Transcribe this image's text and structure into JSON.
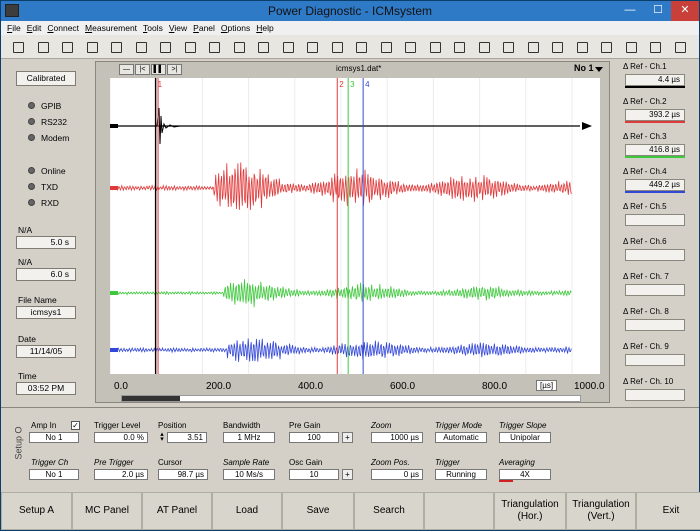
{
  "window": {
    "title": "Power Diagnostic - ICMsystem",
    "controls": [
      "—",
      "☐",
      "✕"
    ]
  },
  "menu": [
    "File",
    "Edit",
    "Connect",
    "Measurement",
    "Tools",
    "View",
    "Panel",
    "Options",
    "Help"
  ],
  "toolbar_icons": [
    "open-icon",
    "save-icon",
    "print-icon",
    "grid-icon",
    "stop-icon",
    "text-icon",
    "bars-icon",
    "chart-icon",
    "spectrum-icon",
    "spectrum2-icon",
    "list-icon",
    "table-icon",
    "waveform-icon",
    "waveform2-icon",
    "overlay-icon",
    "scan-icon",
    "scope-icon",
    "filter-icon",
    "peak-icon",
    "envelope-icon",
    "grid2-icon",
    "lines-icon",
    "percent-icon",
    "sigma-icon",
    "columns-icon",
    "sort-icon",
    "help-icon",
    "about-icon"
  ],
  "left": {
    "status": "Calibrated",
    "interfaces": [
      "GPIB",
      "RS232",
      "Modem"
    ],
    "indicators": [
      "Online",
      "TXD",
      "RXD"
    ],
    "na1_label": "N/A",
    "na1_value": "5.0  s",
    "na2_label": "N/A",
    "na2_value": "6.0  s",
    "file_label": "File Name",
    "file_value": "icmsys1",
    "date_label": "Date",
    "date_value": "11/14/05",
    "time_label": "Time",
    "time_value": "03:52 PM"
  },
  "plot": {
    "filename": "icmsys1.dat*",
    "channel": "No 1",
    "nav": [
      "—",
      "|<",
      "▌▌",
      ">|"
    ],
    "cursor_labels": [
      "1",
      "2",
      "3",
      "4"
    ],
    "ticks": [
      "0.0",
      "200.0",
      "400.0",
      "600.0",
      "800.0",
      "1000.0"
    ],
    "unit": "[µs]",
    "colors": {
      "ch1": "#000000",
      "ch2": "#e0393a",
      "ch3": "#3ec83c",
      "ch4": "#3448d8"
    }
  },
  "refs": [
    {
      "label": "Δ Ref - Ch.1",
      "value": "4.4 µs",
      "color": "#000000"
    },
    {
      "label": "Δ Ref - Ch.2",
      "value": "393.2 µs",
      "color": "#e0393a"
    },
    {
      "label": "Δ Ref - Ch.3",
      "value": "416.8 µs",
      "color": "#3ec83c"
    },
    {
      "label": "Δ Ref - Ch.4",
      "value": "449.2 µs",
      "color": "#3448d8"
    },
    {
      "label": "Δ Ref - Ch.5",
      "value": "",
      "color": ""
    },
    {
      "label": "Δ Ref - Ch.6",
      "value": "",
      "color": ""
    },
    {
      "label": "Δ Ref - Ch. 7",
      "value": "",
      "color": ""
    },
    {
      "label": "Δ Ref - Ch. 8",
      "value": "",
      "color": ""
    },
    {
      "label": "Δ Ref - Ch. 9",
      "value": "",
      "color": ""
    },
    {
      "label": "Δ Ref - Ch. 10",
      "value": "",
      "color": ""
    }
  ],
  "setup": {
    "side_label": "Setup O",
    "amp_in": {
      "label": "Amp In",
      "value": "No 1",
      "checked": "✓"
    },
    "trigger_level": {
      "label": "Trigger Level",
      "value": "0.0 %"
    },
    "position": {
      "label": "Position",
      "value": "3.51"
    },
    "bandwidth": {
      "label": "Bandwidth",
      "value": "1 MHz"
    },
    "pre_gain": {
      "label": "Pre Gain",
      "value": "100",
      "btn": "+"
    },
    "zoom": {
      "label": "Zoom",
      "value": "1000 µs"
    },
    "trigger_mode": {
      "label": "Trigger Mode",
      "value": "Automatic"
    },
    "trigger_slope": {
      "label": "Trigger Slope",
      "value": "Unipolar"
    },
    "trigger_ch": {
      "label": "Trigger Ch",
      "value": "No 1"
    },
    "pre_trigger": {
      "label": "Pre Trigger",
      "value": "2.0 µs"
    },
    "cursor": {
      "label": "Cursor",
      "value": "98.7 µs"
    },
    "sample_rate": {
      "label": "Sample Rate",
      "value": "10 Ms/s"
    },
    "osc_gain": {
      "label": "Osc Gain",
      "value": "10",
      "btn": "+"
    },
    "zoom_pos": {
      "label": "Zoom Pos.",
      "value": "0 µs"
    },
    "trigger": {
      "label": "Trigger",
      "value": "Running"
    },
    "averaging": {
      "label": "Averaging",
      "value": "4X"
    }
  },
  "fbuttons": [
    "Setup A",
    "MC Panel",
    "AT Panel",
    "Load",
    "Save",
    "Search",
    "",
    "Triangulation (Hor.)",
    "Triangulation (Vert.)",
    "Exit"
  ]
}
